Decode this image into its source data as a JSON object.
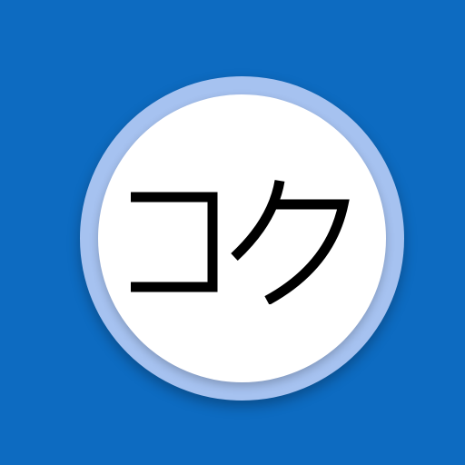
{
  "icon": {
    "text": "コク",
    "background_color": "#0D6BC1",
    "ring_color": "#A6C2F0",
    "disc_color": "#FFFFFF",
    "text_color": "#000000"
  }
}
